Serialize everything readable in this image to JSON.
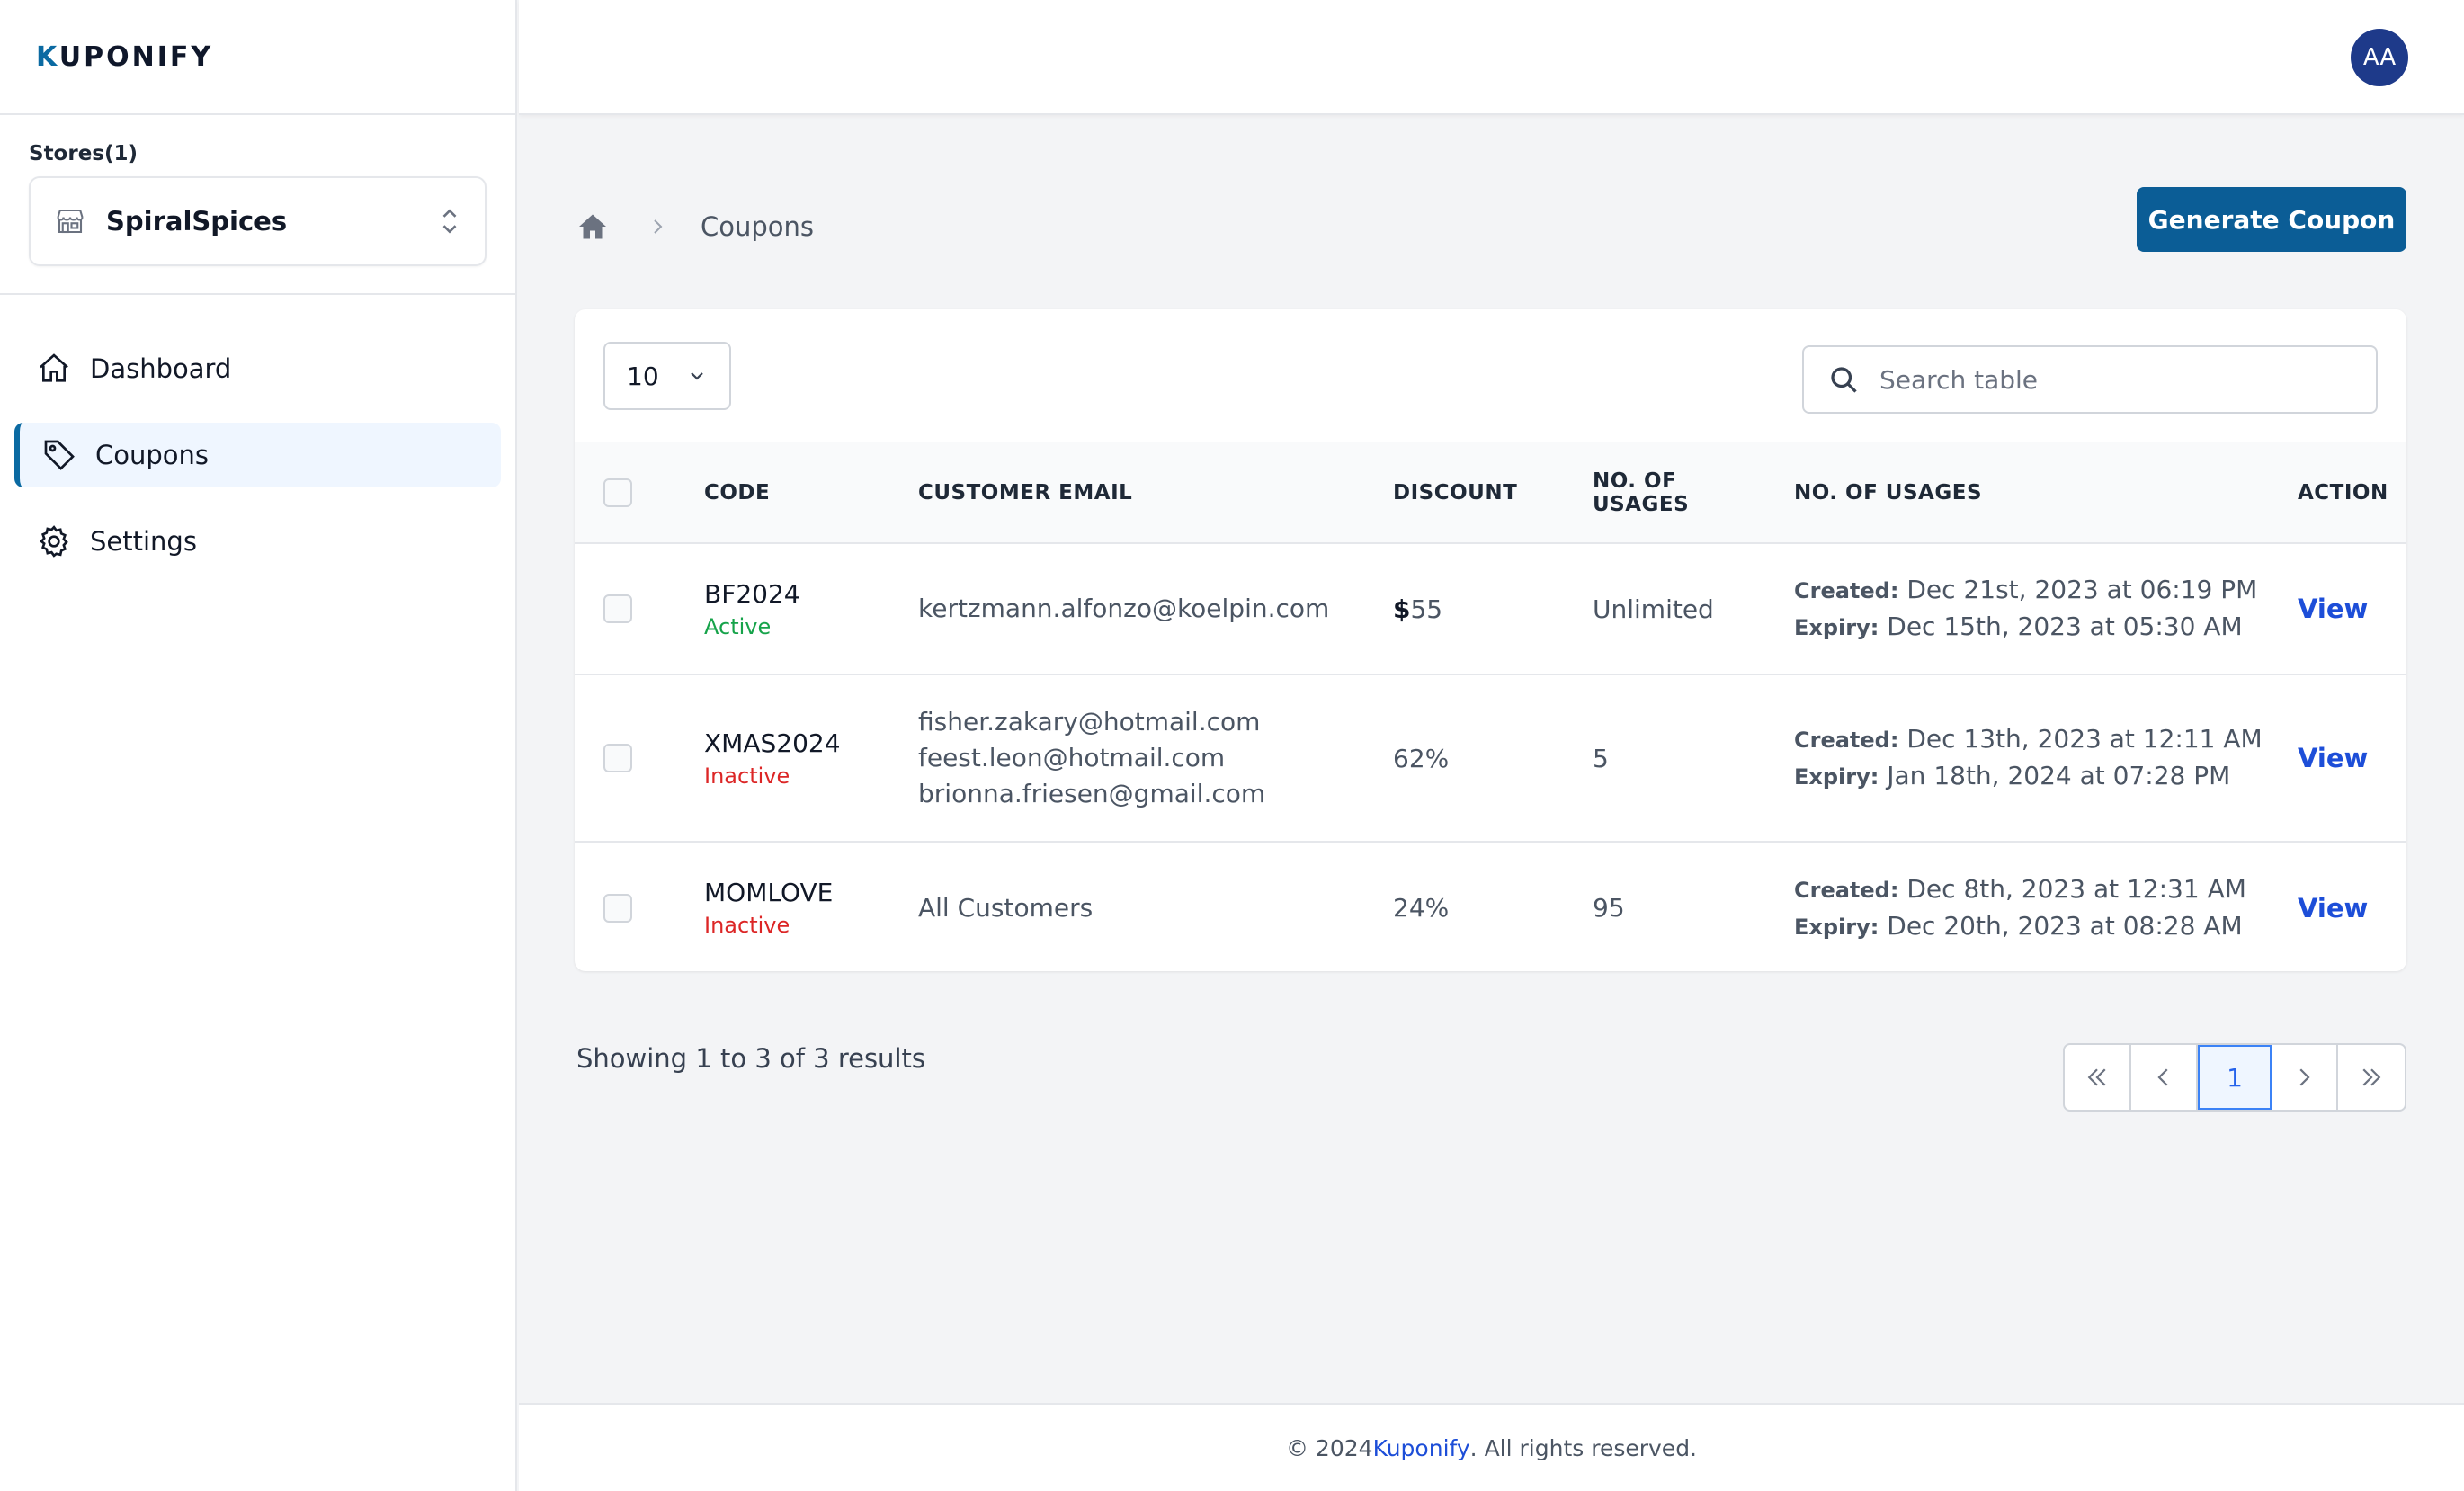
{
  "app": {
    "logo_text": "KUPONIFY",
    "logo_first": "K",
    "logo_rest": "UPONIFY"
  },
  "sidebar": {
    "stores_label": "Stores(1)",
    "store_name": "SpiralSpices",
    "nav": [
      {
        "label": "Dashboard",
        "icon": "home-icon"
      },
      {
        "label": "Coupons",
        "icon": "tag-icon",
        "active": true
      },
      {
        "label": "Settings",
        "icon": "gear-icon"
      }
    ]
  },
  "header": {
    "avatar_initials": "AA"
  },
  "breadcrumb": {
    "current": "Coupons"
  },
  "actions": {
    "generate_label": "Generate Coupon"
  },
  "table_controls": {
    "per_page": "10",
    "search_placeholder": "Search table"
  },
  "table": {
    "headers": {
      "code": "CODE",
      "email": "CUSTOMER EMAIL",
      "discount": "DISCOUNT",
      "usages_line1": "NO. OF",
      "usages_line2": "USAGES",
      "dates": "NO. OF USAGES",
      "action": "ACTION"
    },
    "created_label": "Created:",
    "expiry_label": "Expiry:",
    "view_label": "View",
    "rows": [
      {
        "code": "BF2024",
        "status": "Active",
        "emails": [
          "kertzmann.alfonzo@koelpin.com"
        ],
        "discount_symbol": "$",
        "discount": "55",
        "usages": "Unlimited",
        "created": "Dec 21st, 2023 at 06:19 PM",
        "expiry": "Dec 15th, 2023 at 05:30 AM"
      },
      {
        "code": "XMAS2024",
        "status": "Inactive",
        "emails": [
          "fisher.zakary@hotmail.com",
          "feest.leon@hotmail.com",
          "brionna.friesen@gmail.com"
        ],
        "discount_symbol": "",
        "discount": "62%",
        "usages": "5",
        "created": "Dec 13th, 2023 at 12:11 AM",
        "expiry": "Jan 18th, 2024 at 07:28 PM"
      },
      {
        "code": "MOMLOVE",
        "status": "Inactive",
        "emails": [
          "All Customers"
        ],
        "discount_symbol": "",
        "discount": "24%",
        "usages": "95",
        "created": "Dec 8th, 2023 at 12:31 AM",
        "expiry": "Dec 20th, 2023 at 08:28 AM"
      }
    ]
  },
  "pagination": {
    "showing_text": "Showing 1 to 3 of 3 results",
    "current_page": "1"
  },
  "footer": {
    "prefix": "© 2024 ",
    "brand": "Kuponify",
    "suffix": ". All rights reserved."
  },
  "colors": {
    "brand": "#0b5d96",
    "active": "#16a34a",
    "inactive": "#dc2626",
    "link": "#1d4ed8"
  }
}
